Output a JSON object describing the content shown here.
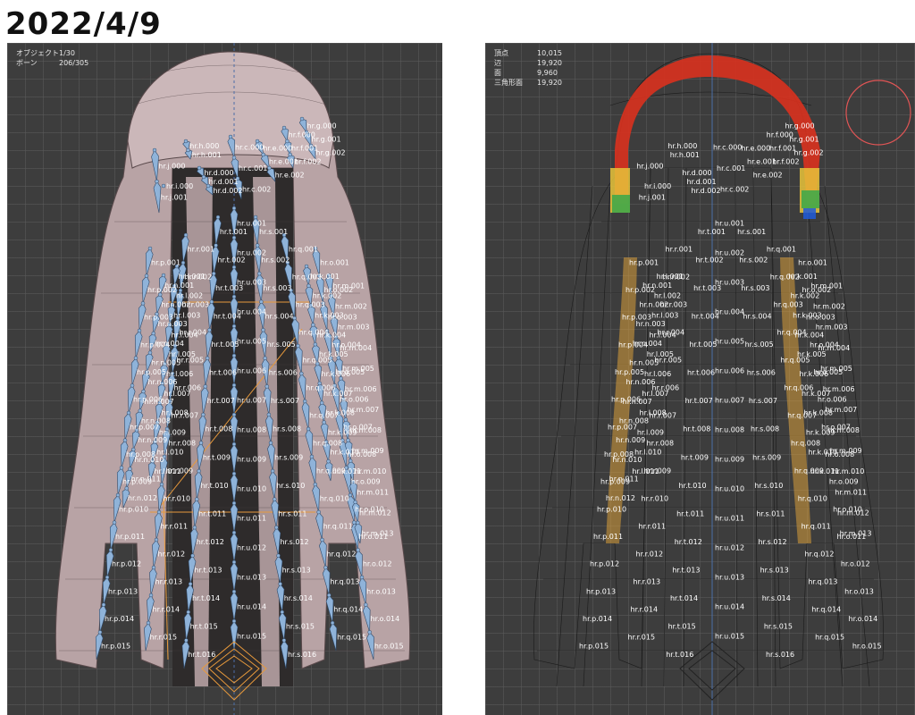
{
  "header": {
    "date": "2022/4/9"
  },
  "left_viewport": {
    "stats": [
      {
        "label": "オブジェクト",
        "value": "1/30"
      },
      {
        "label": "ボーン",
        "value": "206/305"
      }
    ]
  },
  "right_viewport": {
    "stats": [
      {
        "label": "頂点",
        "value": "10,015"
      },
      {
        "label": "辺",
        "value": "19,920"
      },
      {
        "label": "面",
        "value": "9,960"
      },
      {
        "label": "三角形面",
        "value": "19,920"
      }
    ]
  },
  "bone_chains": [
    {
      "name": "hr.u",
      "labels": [
        "hr.u.001",
        "hr.u.002",
        "hr.u.003",
        "hr.u.004",
        "hr.u.005",
        "hr.u.006",
        "hr.u.007",
        "hr.u.008",
        "hr.u.009",
        "hr.u.010",
        "hr.u.011",
        "hr.u.012",
        "hr.u.013",
        "hr.u.014",
        "hr.u.015"
      ]
    },
    {
      "name": "hr.t",
      "labels": [
        "hr.t.001",
        "hr.t.002",
        "hr.t.003",
        "hr.t.004",
        "hr.t.005",
        "hr.t.006",
        "hr.t.007",
        "hr.t.008",
        "hr.t.009",
        "hr.t.010",
        "hr.t.011",
        "hr.t.012",
        "hr.t.013",
        "hr.t.014",
        "hr.t.015",
        "hr.t.016"
      ]
    },
    {
      "name": "hr.s",
      "labels": [
        "hr.s.001",
        "hr.s.002",
        "hr.s.003",
        "hr.s.004",
        "hr.s.005",
        "hr.s.006",
        "hr.s.007",
        "hr.s.008",
        "hr.s.009",
        "hr.s.010",
        "hr.s.011",
        "hr.s.012",
        "hr.s.013",
        "hr.s.014",
        "hr.s.015",
        "hr.s.016"
      ]
    },
    {
      "name": "hr.r",
      "labels": [
        "hr.r.001",
        "hr.r.002",
        "hr.r.003",
        "hr.r.004",
        "hr.r.005",
        "hr.r.006",
        "hr.r.007",
        "hr.r.008",
        "hr.r.009",
        "hr.r.010",
        "hr.r.011",
        "hr.r.012",
        "hr.r.013",
        "hr.r.014",
        "hr.r.015"
      ]
    },
    {
      "name": "hr.q",
      "labels": [
        "hr.q.001",
        "hr.q.002",
        "hr.q.003",
        "hr.q.004",
        "hr.q.005",
        "hr.q.006",
        "hr.q.007",
        "hr.q.008",
        "hr.q.009",
        "hr.q.010",
        "hr.q.011",
        "hr.q.012",
        "hr.q.013",
        "hr.q.014",
        "hr.q.015"
      ]
    },
    {
      "name": "hr.p",
      "labels": [
        "hr.p.001",
        "hr.p.002",
        "hr.p.003",
        "hr.p.004",
        "hr.p.005",
        "hr.p.006",
        "hr.p.007",
        "hr.p.008",
        "hr.p.009",
        "hr.p.010",
        "hr.p.011",
        "hr.p.012",
        "hr.p.013",
        "hr.p.014",
        "hr.p.015"
      ]
    },
    {
      "name": "hr.o",
      "labels": [
        "hr.o.001",
        "hr.o.002",
        "hr.o.003",
        "hr.o.004",
        "hr.o.005",
        "hr.o.006",
        "hr.o.007",
        "hr.o.008",
        "hr.o.009",
        "hr.o.010",
        "hr.o.011",
        "hr.o.012",
        "hr.o.013",
        "hr.o.014",
        "hr.o.015"
      ]
    },
    {
      "name": "hr.n",
      "labels": [
        "hr.n.001",
        "hr.n.002",
        "hr.n.003",
        "hr.n.004",
        "hr.n.005",
        "hr.n.006",
        "hr.n.007",
        "hr.n.008",
        "hr.n.009",
        "hr.n.010",
        "hr.n.011",
        "hr.n.012"
      ]
    },
    {
      "name": "hr.m",
      "labels": [
        "hr.m.001",
        "hr.m.002",
        "hr.m.003",
        "hr.m.004",
        "hr.m.005",
        "hr.m.006",
        "hr.m.007",
        "hr.m.008",
        "hr.m.009",
        "hr.m.010",
        "hr.m.011",
        "hr.m.012",
        "hr.m.013"
      ]
    },
    {
      "name": "hr.l",
      "labels": [
        "hr.l.001",
        "hr.l.002",
        "hr.l.003",
        "hr.l.004",
        "hr.l.005",
        "hr.l.006",
        "hr.l.007",
        "hr.l.008",
        "hr.l.009",
        "hr.l.010",
        "hr.l.011"
      ]
    },
    {
      "name": "hr.k",
      "labels": [
        "hr.k.001",
        "hr.k.002",
        "hr.k.003",
        "hr.k.004",
        "hr.k.005",
        "hr.k.006",
        "hr.k.007",
        "hr.k.008",
        "hr.k.009",
        "hr.k.010",
        "hr.k.011"
      ]
    },
    {
      "name": "hr.j",
      "labels": [
        "hr.j.000",
        "hr.j.001"
      ]
    },
    {
      "name": "hr.i",
      "labels": [
        "hr.i.000"
      ]
    },
    {
      "name": "hr.h",
      "labels": [
        "hr.h.000",
        "hr.h.001"
      ]
    },
    {
      "name": "hr.d",
      "labels": [
        "hr.d.000",
        "hr.d.001",
        "hr.d.002"
      ]
    },
    {
      "name": "hr.c",
      "labels": [
        "hr.c.000",
        "hr.c.001",
        "hr.c.002"
      ]
    },
    {
      "name": "hr.e",
      "labels": [
        "hr.e.000",
        "hr.e.001",
        "hr.e.002"
      ]
    },
    {
      "name": "hr.f",
      "labels": [
        "hr.f.000",
        "hr.f.001",
        "hr.f.002"
      ]
    },
    {
      "name": "hr.g",
      "labels": [
        "hr.g.000",
        "hr.g.001",
        "hr.g.002"
      ]
    }
  ],
  "colors": {
    "viewport_bg": "#3d3d3d",
    "hair_mesh": "#b8a3a5",
    "bone_fill": "#8fb3d9",
    "ik_line": "#e89a3c",
    "weight_hot": "#d9311e",
    "weight_cold": "#1e5bd9",
    "selection_ring": "#e05555"
  }
}
